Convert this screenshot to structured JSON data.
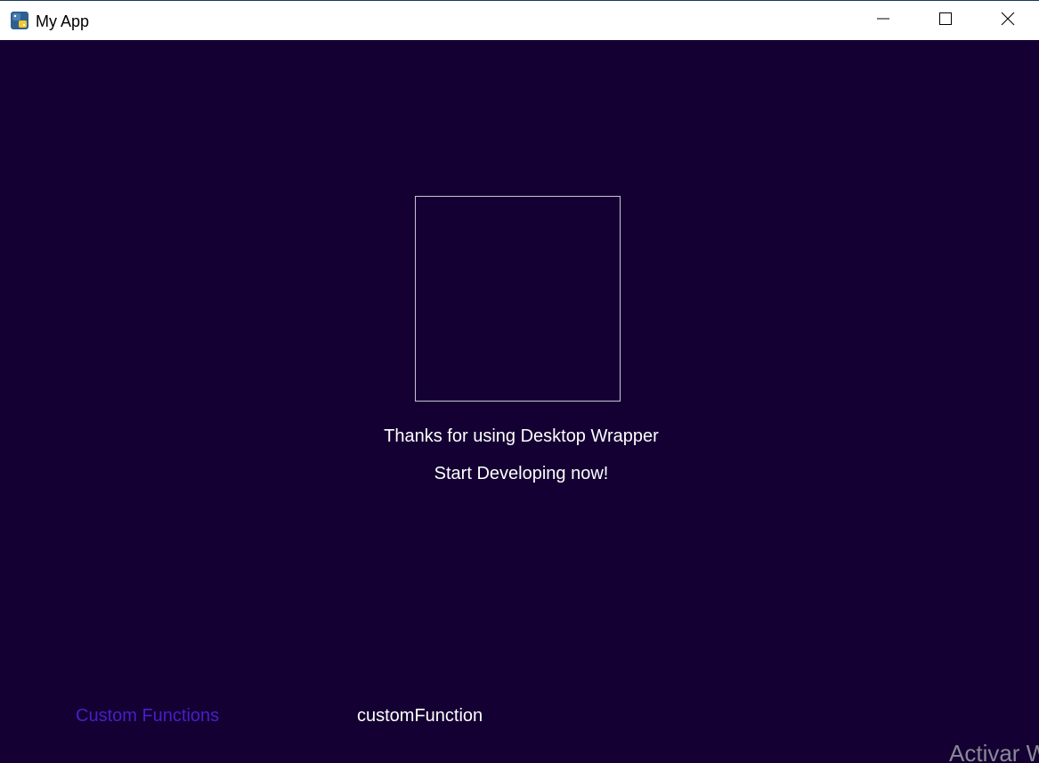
{
  "window": {
    "title": "My App",
    "background": "#140033",
    "app_icon": "python-icon",
    "controls": {
      "minimize_icon": "minimize-icon",
      "maximize_icon": "maximize-icon",
      "close_icon": "close-icon"
    }
  },
  "main": {
    "image_placeholder": "empty-image-frame",
    "thanks_text": "Thanks for using Desktop Wrapper",
    "start_text": "Start Developing now!"
  },
  "footer": {
    "custom_functions_label": "Custom Functions",
    "custom_functions_color": "#4a1fc7",
    "custom_function_name": "customFunction"
  },
  "watermark": {
    "text": "Activar W"
  }
}
